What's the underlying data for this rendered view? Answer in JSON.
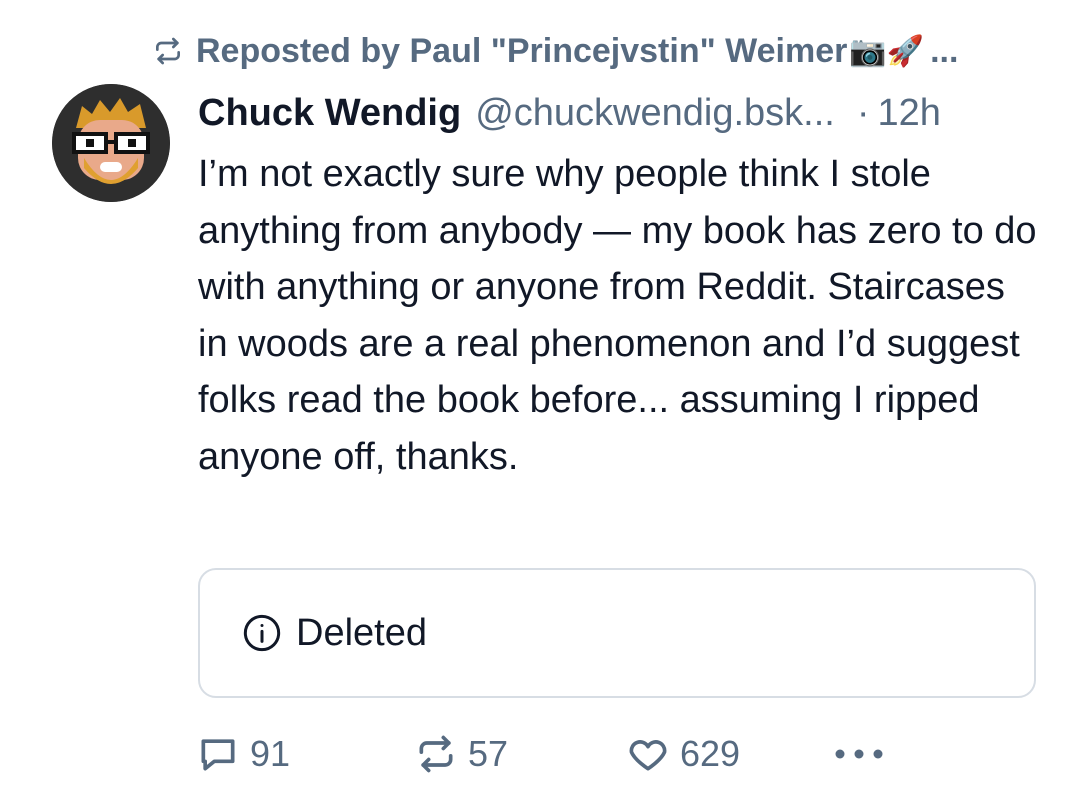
{
  "repost": {
    "label": "Reposted by Paul \"Princejvstin\" Weimer",
    "emoji": "📷🚀",
    "ellipsis": "..."
  },
  "post": {
    "author_name": "Chuck Wendig",
    "handle": "@chuckwendig.bsk...",
    "separator": "·",
    "time": "12h",
    "text": "I’m not exactly sure why people think I stole anything from anybody — my book has zero to do with anything or anyone from Reddit. Staircases in woods are a real phenomenon and I’d suggest folks read the book before... assuming I ripped anyone off, thanks.",
    "embed_label": "Deleted"
  },
  "actions": {
    "reply_count": "91",
    "repost_count": "57",
    "like_count": "629"
  },
  "colors": {
    "muted": "#566a80",
    "text": "#111827",
    "border": "#d7dde4"
  },
  "icons": [
    "repost-icon",
    "info-icon",
    "reply-icon",
    "like-icon",
    "more-icon",
    "camera-emoji",
    "rocket-emoji"
  ]
}
